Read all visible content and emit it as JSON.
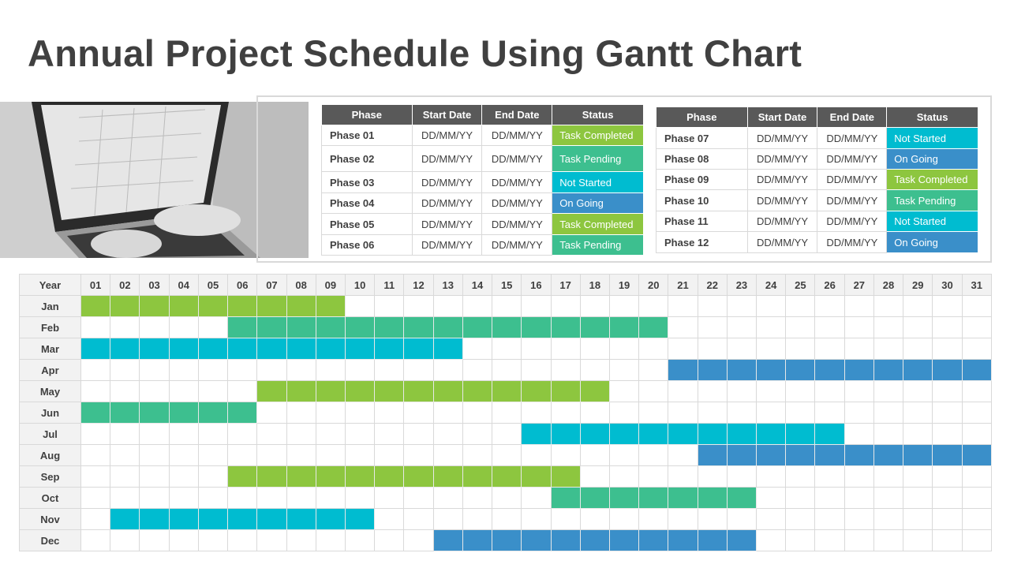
{
  "title": "Annual Project Schedule Using Gantt Chart",
  "colors": {
    "Task Completed": "#8dc63f",
    "Task Pending": "#3dbf8f",
    "Not Started": "#00bcd0",
    "On Going": "#3a8fc9",
    "header": "#595959"
  },
  "table_headers": [
    "Phase",
    "Start Date",
    "End Date",
    "Status"
  ],
  "table_left": [
    {
      "phase": "Phase 01",
      "start": "DD/MM/YY",
      "end": "DD/MM/YY",
      "status": "Task Completed"
    },
    {
      "phase": "Phase 02",
      "start": "DD/MM/YY",
      "end": "DD/MM/YY",
      "status": "Task Pending"
    },
    {
      "phase": "Phase 03",
      "start": "DD/MM/YY",
      "end": "DD/MM/YY",
      "status": "Not Started"
    },
    {
      "phase": "Phase 04",
      "start": "DD/MM/YY",
      "end": "DD/MM/YY",
      "status": "On Going"
    },
    {
      "phase": "Phase 05",
      "start": "DD/MM/YY",
      "end": "DD/MM/YY",
      "status": "Task Completed"
    },
    {
      "phase": "Phase 06",
      "start": "DD/MM/YY",
      "end": "DD/MM/YY",
      "status": "Task Pending"
    }
  ],
  "table_right": [
    {
      "phase": "Phase 07",
      "start": "DD/MM/YY",
      "end": "DD/MM/YY",
      "status": "Not Started"
    },
    {
      "phase": "Phase 08",
      "start": "DD/MM/YY",
      "end": "DD/MM/YY",
      "status": "On Going"
    },
    {
      "phase": "Phase 09",
      "start": "DD/MM/YY",
      "end": "DD/MM/YY",
      "status": "Task Completed"
    },
    {
      "phase": "Phase 10",
      "start": "DD/MM/YY",
      "end": "DD/MM/YY",
      "status": "Task Pending"
    },
    {
      "phase": "Phase 11",
      "start": "DD/MM/YY",
      "end": "DD/MM/YY",
      "status": "Not Started"
    },
    {
      "phase": "Phase 12",
      "start": "DD/MM/YY",
      "end": "DD/MM/YY",
      "status": "On Going"
    }
  ],
  "gantt": {
    "corner": "Year",
    "days": [
      "01",
      "02",
      "03",
      "04",
      "05",
      "06",
      "07",
      "08",
      "09",
      "10",
      "11",
      "12",
      "13",
      "14",
      "15",
      "16",
      "17",
      "18",
      "19",
      "20",
      "21",
      "22",
      "23",
      "24",
      "25",
      "26",
      "27",
      "28",
      "29",
      "30",
      "31"
    ],
    "rows": [
      {
        "month": "Jan",
        "start": 1,
        "end": 9,
        "status": "Task Completed"
      },
      {
        "month": "Feb",
        "start": 6,
        "end": 20,
        "status": "Task Pending"
      },
      {
        "month": "Mar",
        "start": 1,
        "end": 13,
        "status": "Not Started"
      },
      {
        "month": "Apr",
        "start": 21,
        "end": 31,
        "status": "On Going"
      },
      {
        "month": "May",
        "start": 7,
        "end": 18,
        "status": "Task Completed"
      },
      {
        "month": "Jun",
        "start": 1,
        "end": 6,
        "status": "Task Pending"
      },
      {
        "month": "Jul",
        "start": 16,
        "end": 26,
        "status": "Not Started"
      },
      {
        "month": "Aug",
        "start": 22,
        "end": 31,
        "status": "On Going"
      },
      {
        "month": "Sep",
        "start": 6,
        "end": 17,
        "status": "Task Completed"
      },
      {
        "month": "Oct",
        "start": 17,
        "end": 23,
        "status": "Task Pending"
      },
      {
        "month": "Nov",
        "start": 2,
        "end": 10,
        "status": "Not Started"
      },
      {
        "month": "Dec",
        "start": 13,
        "end": 23,
        "status": "On Going"
      }
    ]
  }
}
